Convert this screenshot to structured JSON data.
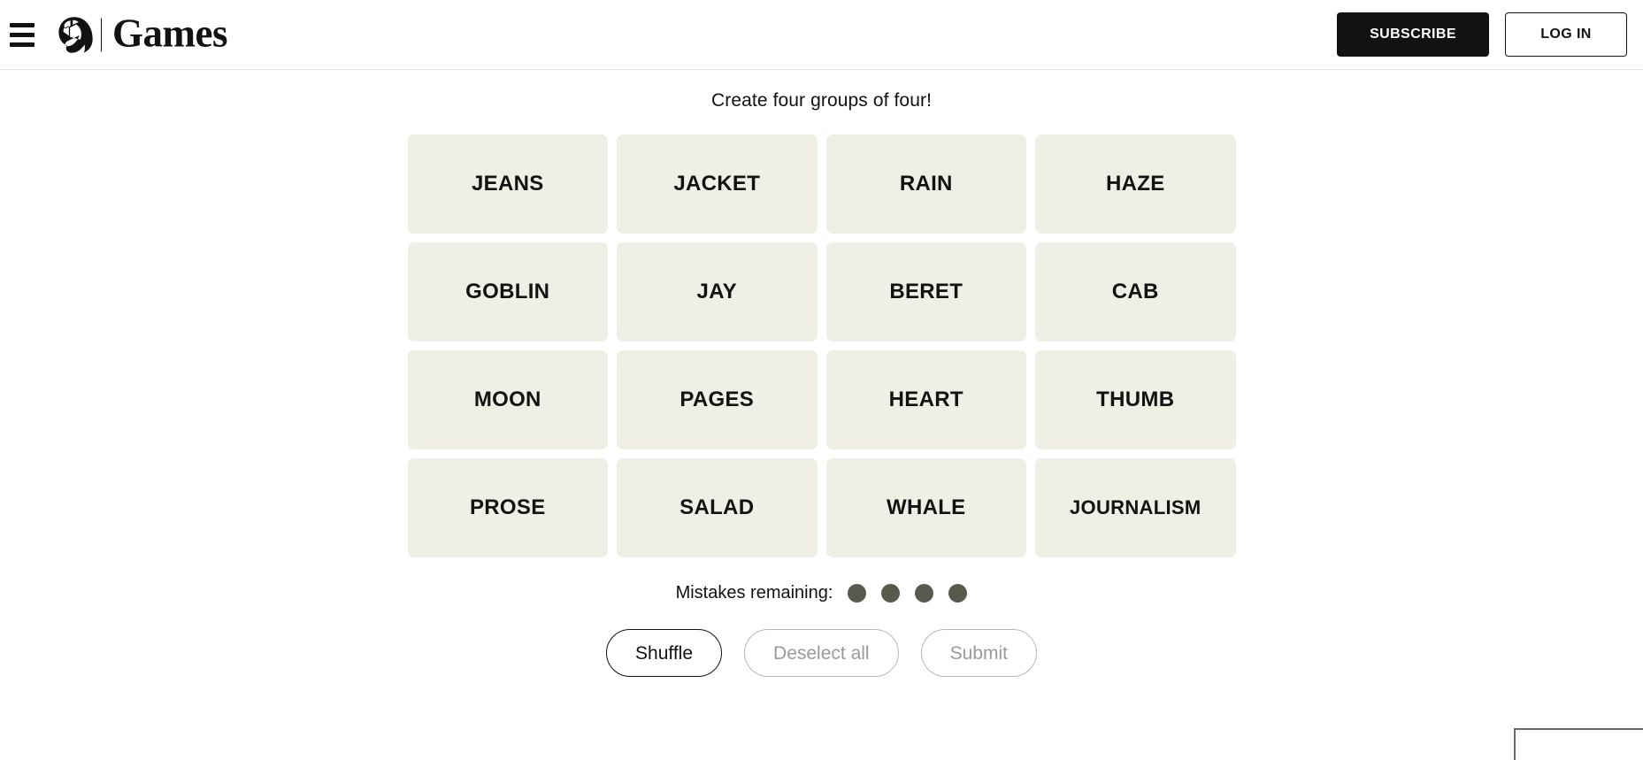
{
  "header": {
    "menu_icon": "hamburger-menu-icon",
    "logo_icon": "nyt-t-logo-icon",
    "brand_name": "Games",
    "subscribe_label": "SUBSCRIBE",
    "login_label": "LOG IN",
    "colors": {
      "subscribe_bg": "#121212",
      "subscribe_text": "#ffffff",
      "login_border": "#121212",
      "border_bottom": "#e2e2e2"
    }
  },
  "game": {
    "instructions": "Create four groups of four!",
    "tile_color": "#efefe6",
    "tiles": [
      "JEANS",
      "JACKET",
      "RAIN",
      "HAZE",
      "GOBLIN",
      "JAY",
      "BERET",
      "CAB",
      "MOON",
      "PAGES",
      "HEART",
      "THUMB",
      "PROSE",
      "SALAD",
      "WHALE",
      "JOURNALISM"
    ],
    "mistakes": {
      "label": "Mistakes remaining:",
      "remaining": 4,
      "dot_color": "#5a594e"
    },
    "controls": [
      {
        "label": "Shuffle",
        "state": "enabled"
      },
      {
        "label": "Deselect all",
        "state": "disabled"
      },
      {
        "label": "Submit",
        "state": "disabled"
      }
    ]
  }
}
